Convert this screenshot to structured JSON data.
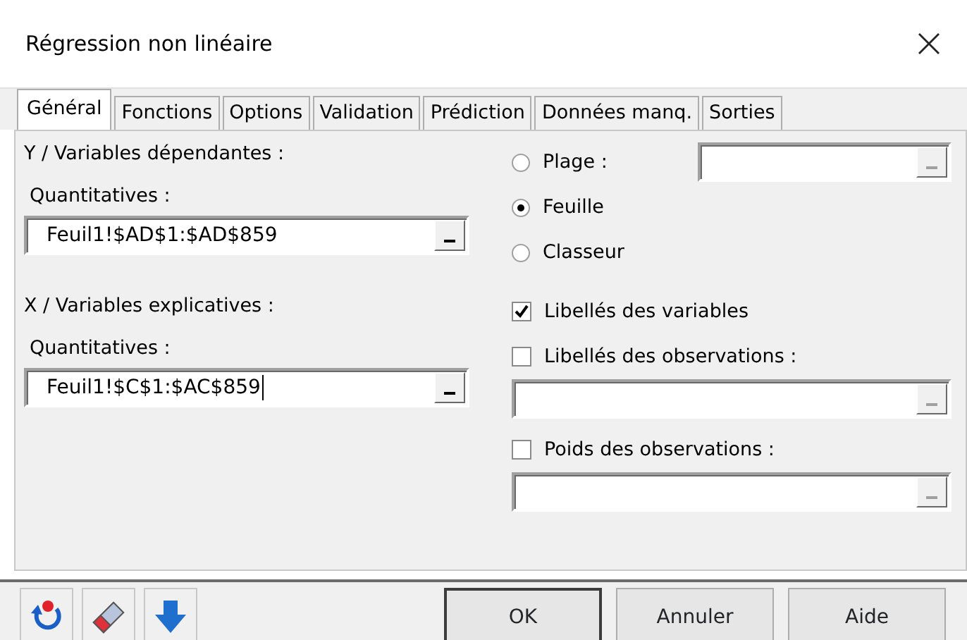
{
  "window": {
    "title": "Régression non linéaire"
  },
  "tabs": [
    {
      "label": "Général",
      "selected": true
    },
    {
      "label": "Fonctions",
      "selected": false
    },
    {
      "label": "Options",
      "selected": false
    },
    {
      "label": "Validation",
      "selected": false
    },
    {
      "label": "Prédiction",
      "selected": false
    },
    {
      "label": "Données manq.",
      "selected": false
    },
    {
      "label": "Sorties",
      "selected": false
    }
  ],
  "variable_groups": [
    {
      "heading": "Y / Variables dépendantes :",
      "label": "Quantitatives :",
      "value": "Feuil1!$AD$1:$AD$859",
      "focused": false
    },
    {
      "heading": "X / Variables explicatives :",
      "label": "Quantitatives :",
      "value": "Feuil1!$C$1:$AC$859",
      "focused": true
    }
  ],
  "range_options": [
    {
      "label": "Plage :",
      "selected": false,
      "has_field": true
    },
    {
      "label": "Feuille",
      "selected": true,
      "has_field": false
    },
    {
      "label": "Classeur",
      "selected": false,
      "has_field": false
    }
  ],
  "checkboxes": [
    {
      "label": "Libellés des variables",
      "checked": true,
      "has_field": false
    },
    {
      "label": "Libellés des observations :",
      "checked": false,
      "has_field": true
    },
    {
      "label": "Poids des observations :",
      "checked": false,
      "has_field": true
    }
  ],
  "buttons": [
    {
      "label": "OK",
      "default": true
    },
    {
      "label": "Annuler",
      "default": false
    },
    {
      "label": "Aide",
      "default": false
    }
  ]
}
